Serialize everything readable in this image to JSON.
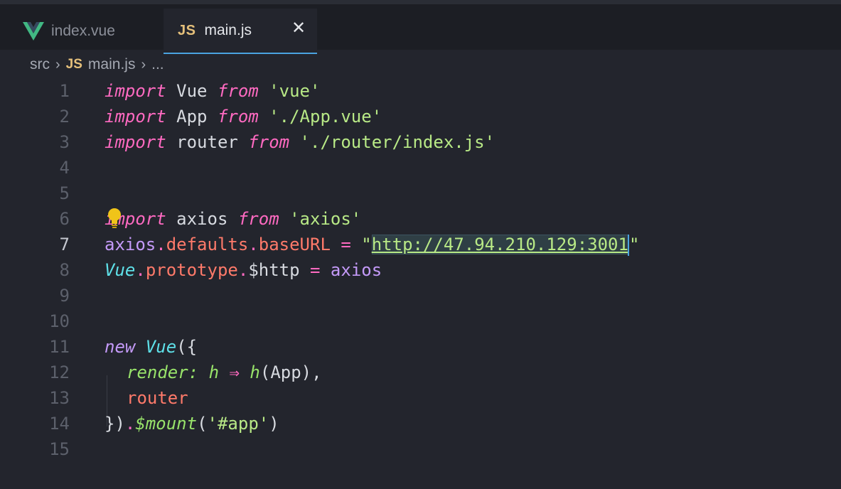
{
  "tabs": [
    {
      "label": "index.vue",
      "icon": "vue-icon",
      "active": false
    },
    {
      "label": "main.js",
      "icon_text": "JS",
      "active": true
    }
  ],
  "breadcrumb": {
    "folder": "src",
    "file_icon_text": "JS",
    "file": "main.js",
    "more": "..."
  },
  "editor": {
    "line_numbers": [
      "1",
      "2",
      "3",
      "4",
      "5",
      "6",
      "7",
      "8",
      "9",
      "10",
      "11",
      "12",
      "13",
      "14",
      "15"
    ],
    "active_line": "7",
    "lines": {
      "l1": {
        "kw1": "import",
        "id": " Vue ",
        "kw2": "from",
        "str": " 'vue'"
      },
      "l2": {
        "kw1": "import",
        "id": " App ",
        "kw2": "from",
        "str": " './App.vue'"
      },
      "l3": {
        "kw1": "import",
        "id": " router ",
        "kw2": "from",
        "str": " './router/index.js'"
      },
      "l6": {
        "kw1": "import",
        "id": " axios ",
        "kw2": "from",
        "str": " 'axios'"
      },
      "l7": {
        "obj": "axios",
        "dot1": ".",
        "prop1": "defaults",
        "dot2": ".",
        "prop2": "baseURL",
        "eq": " = ",
        "q1": "\"",
        "url": "http://47.94.210.129:3001",
        "q2": "\""
      },
      "l8": {
        "cls": "Vue",
        "dot1": ".",
        "prop": "prototype",
        "dot2": ".",
        "id": "$http",
        "eq": " = ",
        "val": "axios"
      },
      "l11": {
        "kw": "new",
        "cls": " Vue",
        "punc": "({"
      },
      "l12": {
        "fn1": "render",
        "colon": ":",
        "param": " h ",
        "arrow": "⇒",
        "fn2": " h",
        "punc": "(App),"
      },
      "l13": {
        "prop": "router"
      },
      "l14": {
        "punc1": "})",
        "dot": ".",
        "fn": "$mount",
        "punc2": "(",
        "str": "'#app'",
        "punc3": ")"
      }
    }
  },
  "colors": {
    "background": "#23252d",
    "keyword": "#ff6ac1",
    "string": "#b8e986",
    "property": "#ff7a6a",
    "class": "#5ee0e8",
    "accent": "#4aa3e0"
  }
}
